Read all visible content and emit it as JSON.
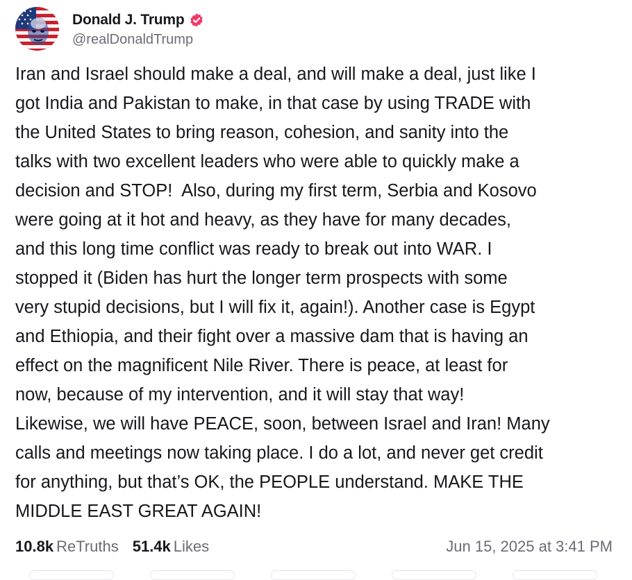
{
  "post": {
    "author": {
      "display_name": "Donald J. Trump",
      "handle": "@realDonaldTrump",
      "verified": true,
      "verified_color": "#f2386a",
      "avatar_icon": "flag-portrait-avatar"
    },
    "text": "Iran and Israel should make a deal, and will make a deal, just like I\ngot India and Pakistan to make, in that case by using TRADE with\nthe United States to bring reason, cohesion, and sanity into the\ntalks with two excellent leaders who were able to quickly make a\ndecision and STOP!  Also, during my first term, Serbia and Kosovo\nwere going at it hot and heavy, as they have for many decades,\nand this long time conflict was ready to break out into WAR. I\nstopped it (Biden has hurt the longer term prospects with some\nvery stupid decisions, but I will fix it, again!). Another case is Egypt\nand Ethiopia, and their fight over a massive dam that is having an\neffect on the magnificent Nile River. There is peace, at least for\nnow, because of my intervention, and it will stay that way!\nLikewise, we will have PEACE, soon, between Israel and Iran! Many\ncalls and meetings now taking place. I do a lot, and never get credit\nfor anything, but that’s OK, the PEOPLE understand. MAKE THE\nMIDDLE EAST GREAT AGAIN!",
    "stats": {
      "retruths_count": "10.8k",
      "retruths_label": "ReTruths",
      "likes_count": "51.4k",
      "likes_label": "Likes"
    },
    "timestamp": "Jun 15, 2025 at 3:41 PM"
  }
}
